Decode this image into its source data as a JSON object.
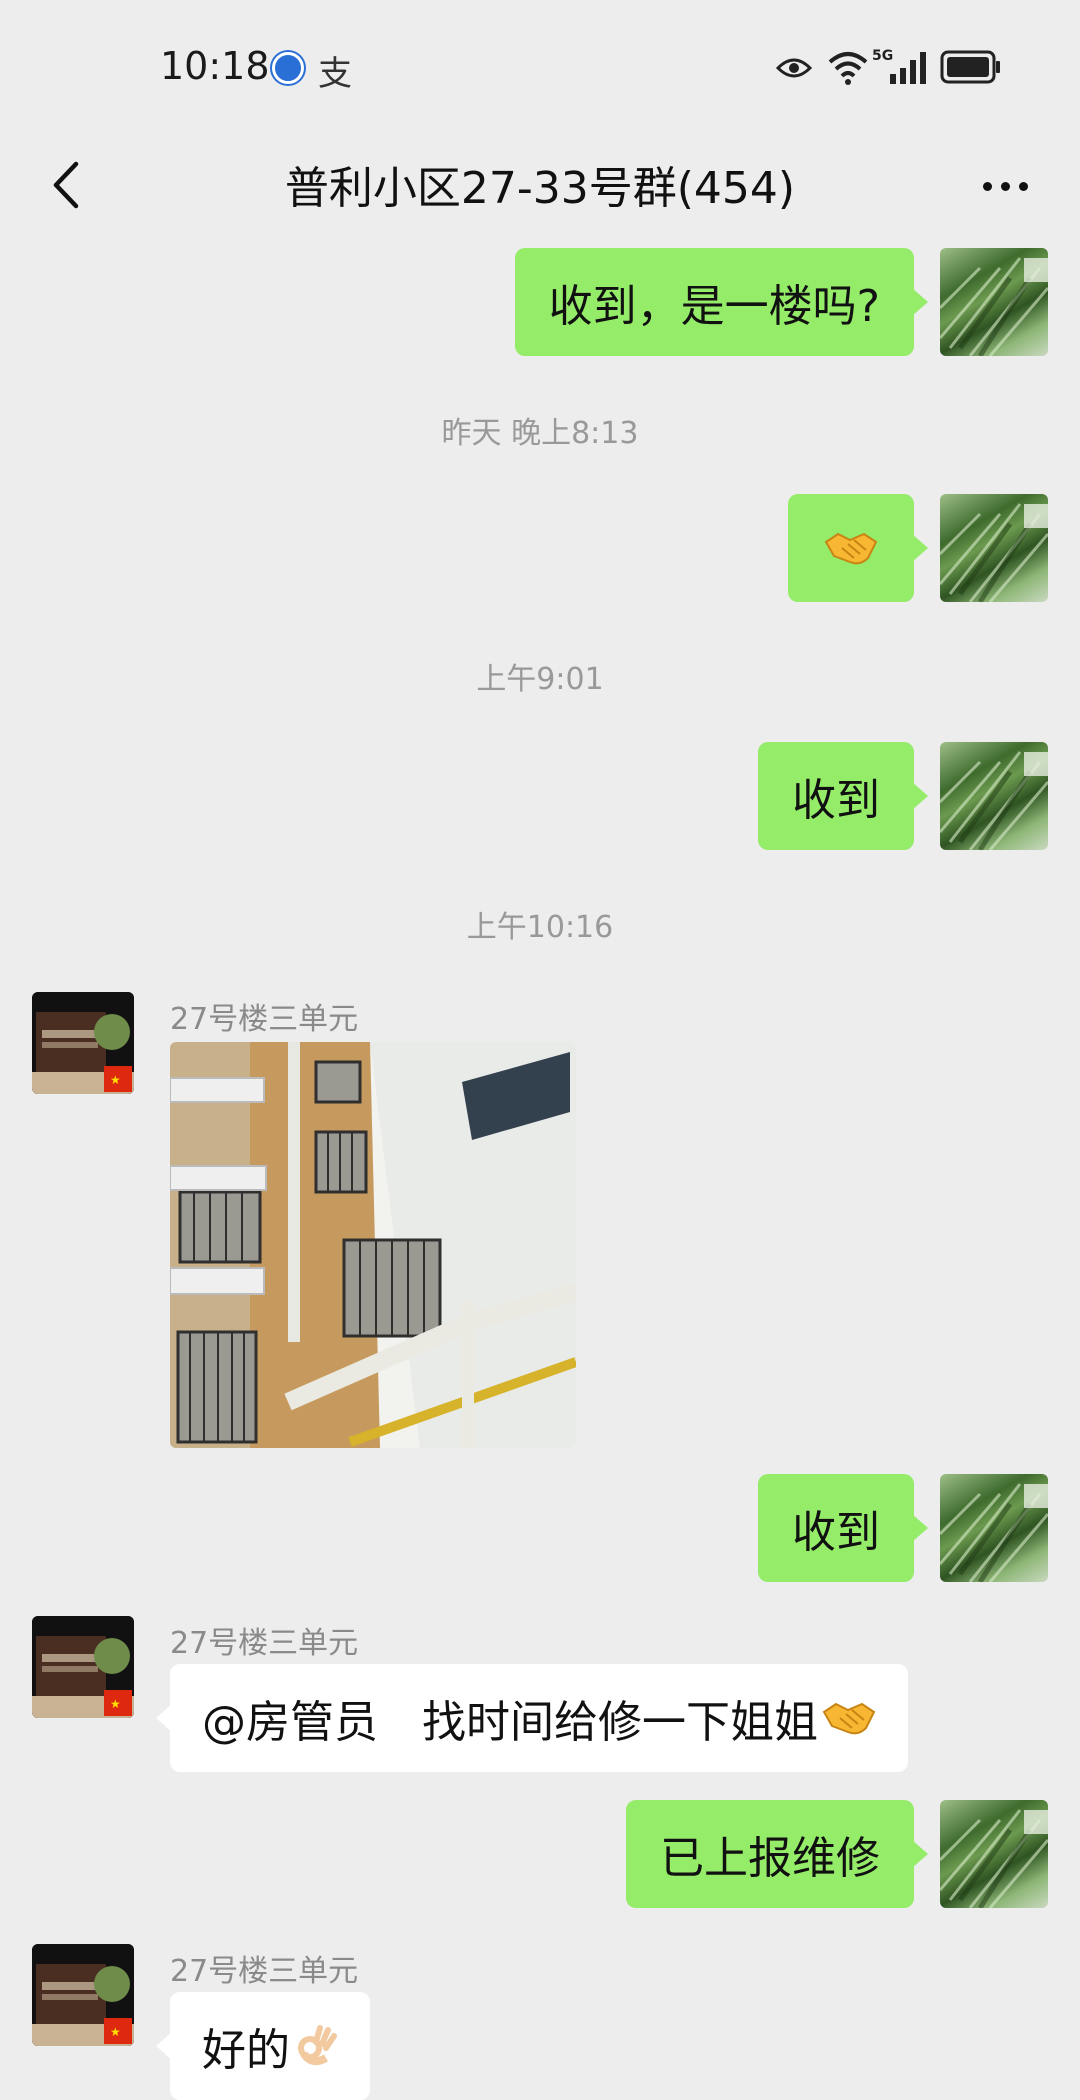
{
  "status_bar": {
    "time": "10:18",
    "app_icon_glyph": "支",
    "network_label": "5G",
    "icons": [
      "globe-app-icon",
      "alipay-icon",
      "eye-comfort-icon",
      "wifi-icon",
      "signal-icon",
      "battery-icon"
    ]
  },
  "nav": {
    "title": "普利小区27-33号群(454)",
    "back_icon": "chevron-left-icon",
    "more_icon": "more-dots-icon"
  },
  "colors": {
    "background": "#ededed",
    "outgoing_bubble": "#95ec69",
    "incoming_bubble": "#ffffff",
    "timestamp_text": "#999999",
    "sender_text": "#8a8a8a"
  },
  "messages": [
    {
      "direction": "out",
      "text": "收到，是一楼吗?"
    },
    {
      "type": "time",
      "text": "昨天 晚上8:13"
    },
    {
      "direction": "out",
      "emoji": "handshake"
    },
    {
      "type": "time",
      "text": "上午9:01"
    },
    {
      "direction": "out",
      "text": "收到"
    },
    {
      "type": "time",
      "text": "上午10:16"
    },
    {
      "direction": "in",
      "sender": "27号楼三单元",
      "image": "building-photo"
    },
    {
      "direction": "out",
      "text": "收到"
    },
    {
      "direction": "in",
      "sender": "27号楼三单元",
      "text": "@房管员　找时间给修一下姐姐",
      "emoji": "handshake"
    },
    {
      "direction": "out",
      "text": "已上报维修"
    },
    {
      "direction": "in",
      "sender": "27号楼三单元",
      "text": "好的",
      "emoji": "ok-hand"
    }
  ]
}
